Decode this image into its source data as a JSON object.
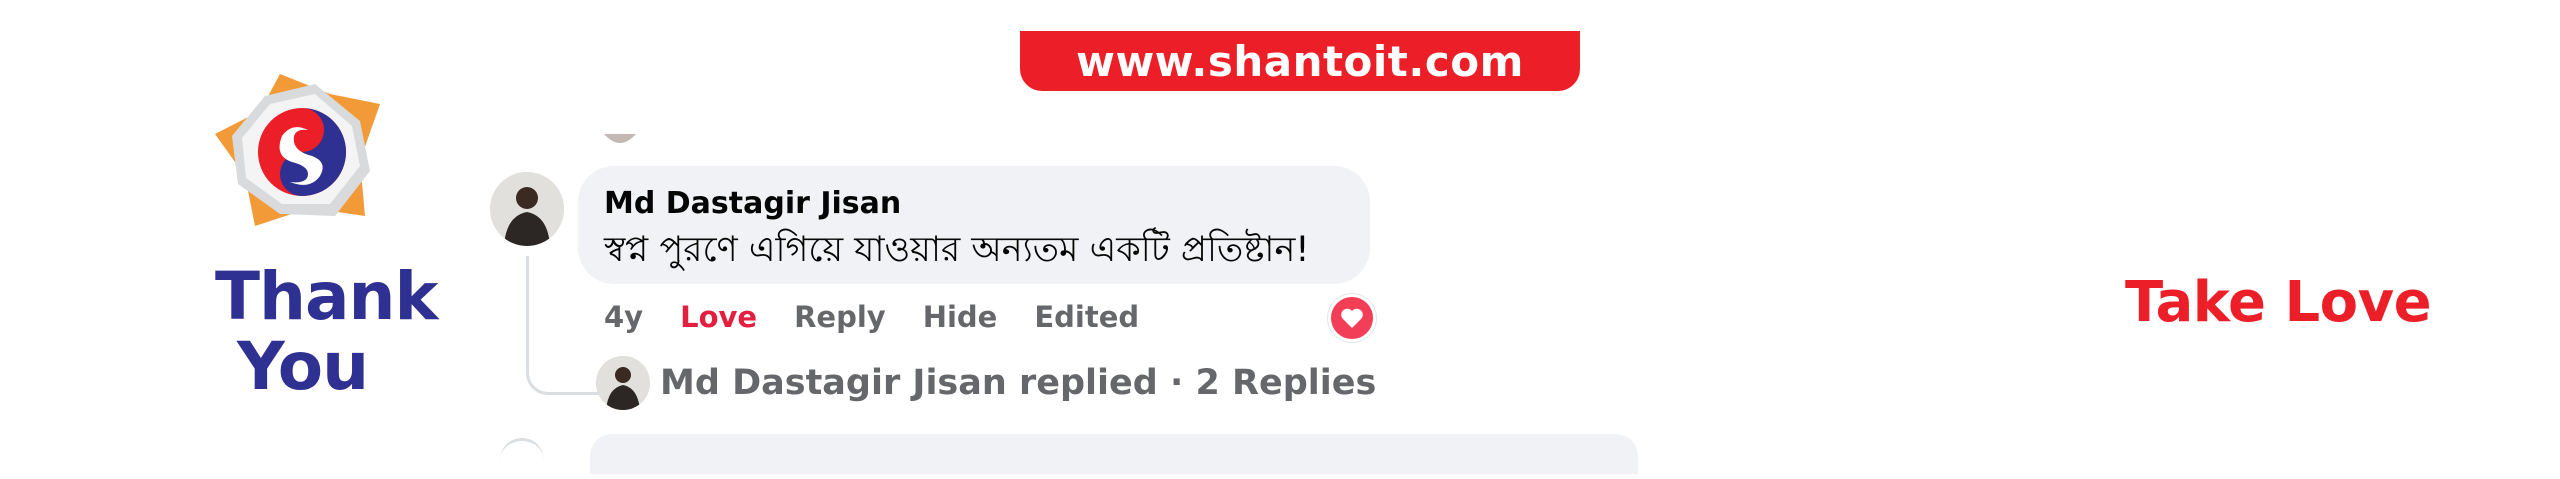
{
  "banner": {
    "url": "www.shantoit.com"
  },
  "brand": {
    "logo_icon": "shantoit-star-logo-icon",
    "thank_line1": "Thank",
    "thank_line2": "You",
    "take_love": "Take Love"
  },
  "comment": {
    "author": "Md Dastagir Jisan",
    "text": "স্বপ্ন পুরণে এগিয়ে যাওয়ার অন্যতম একটি প্রতিষ্টান!",
    "actions": {
      "time": "4y",
      "love": "Love",
      "reply": "Reply",
      "hide": "Hide",
      "edited": "Edited"
    },
    "reaction_icon": "heart-reaction-icon",
    "replies_summary": "Md Dastagir Jisan replied · 2 Replies"
  },
  "colors": {
    "brand_red": "#ec1f28",
    "brand_blue": "#2f3192",
    "love_red": "#e41e3f",
    "bubble_gray": "#f0f2f5",
    "meta_gray": "#65676b"
  }
}
